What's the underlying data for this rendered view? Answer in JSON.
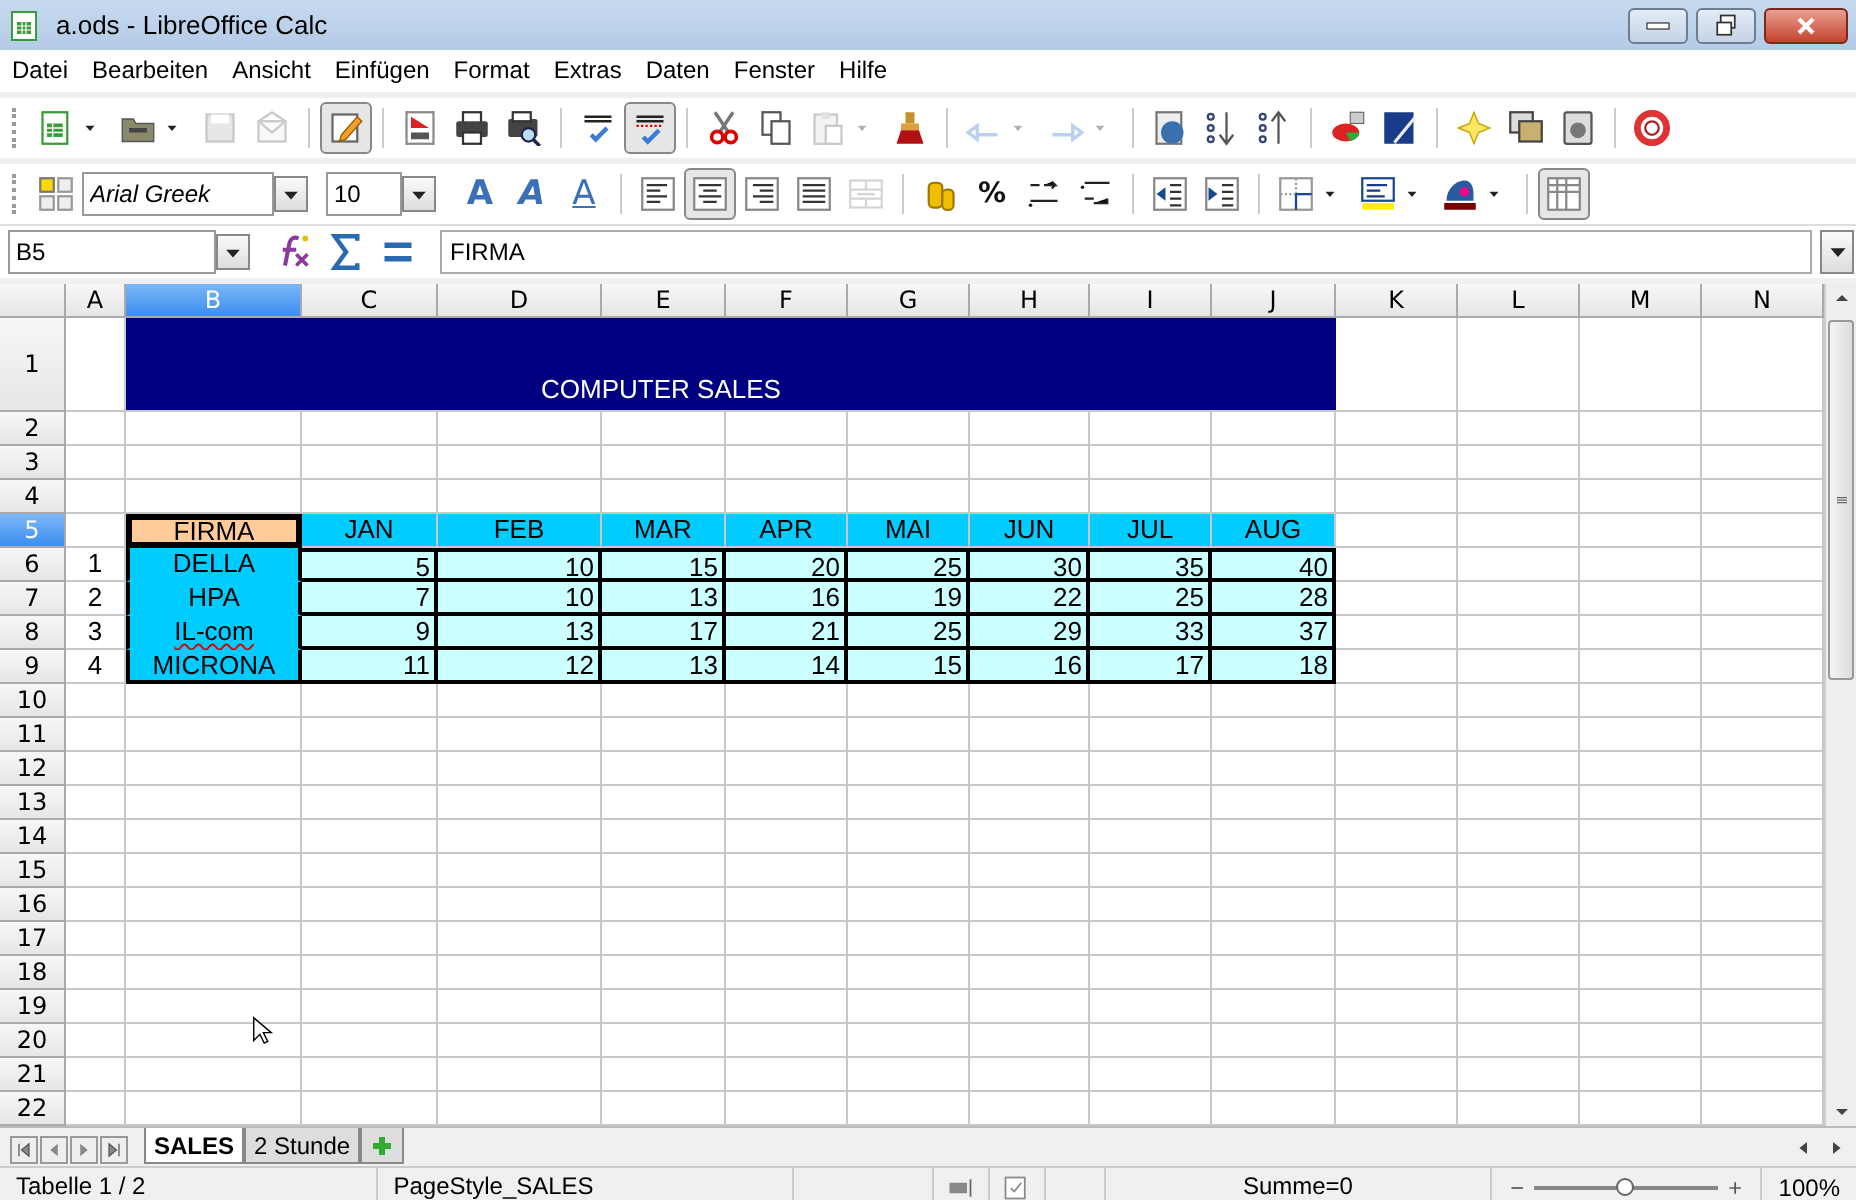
{
  "window": {
    "title": "a.ods - LibreOffice Calc"
  },
  "menu": [
    {
      "label": "Datei"
    },
    {
      "label": "Bearbeiten"
    },
    {
      "label": "Ansicht"
    },
    {
      "label": "Einfügen"
    },
    {
      "label": "Format"
    },
    {
      "label": "Extras"
    },
    {
      "label": "Daten"
    },
    {
      "label": "Fenster"
    },
    {
      "label": "Hilfe"
    }
  ],
  "standard_toolbar": [
    {
      "kind": "new",
      "dropdown": true,
      "pressed": false,
      "disabled": false
    },
    {
      "kind": "open",
      "dropdown": true,
      "pressed": false,
      "disabled": false
    },
    {
      "kind": "save",
      "dropdown": false,
      "pressed": false,
      "disabled": true
    },
    {
      "kind": "email",
      "dropdown": false,
      "pressed": false,
      "disabled": true
    },
    {
      "kind": "separator"
    },
    {
      "kind": "edit",
      "dropdown": false,
      "pressed": true,
      "disabled": false
    },
    {
      "kind": "separator"
    },
    {
      "kind": "pdf",
      "dropdown": false,
      "pressed": false,
      "disabled": false
    },
    {
      "kind": "print",
      "dropdown": false,
      "pressed": false,
      "disabled": false
    },
    {
      "kind": "preview",
      "dropdown": false,
      "pressed": false,
      "disabled": false
    },
    {
      "kind": "separator"
    },
    {
      "kind": "spell",
      "dropdown": false,
      "pressed": false,
      "disabled": false
    },
    {
      "kind": "autospell",
      "dropdown": false,
      "pressed": true,
      "disabled": false
    },
    {
      "kind": "separator"
    },
    {
      "kind": "cut",
      "dropdown": false,
      "pressed": false,
      "disabled": false
    },
    {
      "kind": "copy",
      "dropdown": false,
      "pressed": false,
      "disabled": false
    },
    {
      "kind": "paste",
      "dropdown": true,
      "pressed": false,
      "disabled": true
    },
    {
      "kind": "brush",
      "dropdown": false,
      "pressed": false,
      "disabled": false
    },
    {
      "kind": "separator"
    },
    {
      "kind": "undo",
      "dropdown": true,
      "pressed": false,
      "disabled": true
    },
    {
      "kind": "redo",
      "dropdown": true,
      "pressed": false,
      "disabled": true
    },
    {
      "kind": "separator"
    },
    {
      "kind": "navigator",
      "dropdown": false,
      "pressed": false,
      "disabled": false
    },
    {
      "kind": "sortasc",
      "dropdown": false,
      "pressed": false,
      "disabled": false
    },
    {
      "kind": "sortdesc",
      "dropdown": false,
      "pressed": false,
      "disabled": false
    },
    {
      "kind": "separator"
    },
    {
      "kind": "chart",
      "dropdown": false,
      "pressed": false,
      "disabled": false
    },
    {
      "kind": "draw",
      "dropdown": false,
      "pressed": false,
      "disabled": false
    },
    {
      "kind": "separator"
    },
    {
      "kind": "star",
      "dropdown": false,
      "pressed": false,
      "disabled": false
    },
    {
      "kind": "gallery",
      "dropdown": false,
      "pressed": false,
      "disabled": false
    },
    {
      "kind": "media",
      "dropdown": false,
      "pressed": false,
      "disabled": false
    },
    {
      "kind": "separator"
    },
    {
      "kind": "help",
      "dropdown": false,
      "pressed": false,
      "disabled": false
    }
  ],
  "formatting_toolbar": [
    {
      "kind": "styles",
      "dropdown": false,
      "pressed": false,
      "disabled": false
    },
    {
      "kind": "font-name",
      "value": "Arial Greek"
    },
    {
      "kind": "font-size",
      "value": "10"
    },
    {
      "kind": "bold",
      "glyph": "A",
      "dropdown": false,
      "pressed": false,
      "disabled": false
    },
    {
      "kind": "italic",
      "glyph": "A",
      "dropdown": false,
      "pressed": false,
      "disabled": false
    },
    {
      "kind": "underline",
      "glyph": "A",
      "dropdown": false,
      "pressed": false,
      "disabled": false
    },
    {
      "kind": "separator"
    },
    {
      "kind": "align-left",
      "dropdown": false,
      "pressed": false,
      "disabled": false
    },
    {
      "kind": "align-center",
      "dropdown": false,
      "pressed": true,
      "disabled": false
    },
    {
      "kind": "align-right",
      "dropdown": false,
      "pressed": false,
      "disabled": false
    },
    {
      "kind": "justify",
      "dropdown": false,
      "pressed": false,
      "disabled": false
    },
    {
      "kind": "merge",
      "dropdown": false,
      "pressed": false,
      "disabled": true
    },
    {
      "kind": "separator"
    },
    {
      "kind": "currency",
      "dropdown": false,
      "pressed": false,
      "disabled": false
    },
    {
      "kind": "percent",
      "glyph": "%",
      "dropdown": false,
      "pressed": false,
      "disabled": false
    },
    {
      "kind": "add-decimal",
      "dropdown": false,
      "pressed": false,
      "disabled": false
    },
    {
      "kind": "delete-decimal",
      "dropdown": false,
      "pressed": false,
      "disabled": false
    },
    {
      "kind": "separator"
    },
    {
      "kind": "outdent",
      "dropdown": false,
      "pressed": false,
      "disabled": false
    },
    {
      "kind": "indent",
      "dropdown": false,
      "pressed": false,
      "disabled": false
    },
    {
      "kind": "separator"
    },
    {
      "kind": "borders",
      "dropdown": true,
      "pressed": false,
      "disabled": false
    },
    {
      "kind": "background",
      "dropdown": true,
      "pressed": false,
      "disabled": false
    },
    {
      "kind": "fontcolor",
      "dropdown": true,
      "pressed": false,
      "disabled": false
    },
    {
      "kind": "separator"
    },
    {
      "kind": "gridlines",
      "dropdown": false,
      "pressed": true,
      "disabled": false
    }
  ],
  "formula_bar": {
    "cell_reference": "B5",
    "content": "FIRMA"
  },
  "sheet": {
    "columns": [
      {
        "label": "A",
        "selected": false
      },
      {
        "label": "B",
        "selected": true
      },
      {
        "label": "C",
        "selected": false
      },
      {
        "label": "D",
        "selected": false
      },
      {
        "label": "E",
        "selected": false
      },
      {
        "label": "F",
        "selected": false
      },
      {
        "label": "G",
        "selected": false
      },
      {
        "label": "H",
        "selected": false
      },
      {
        "label": "I",
        "selected": false
      },
      {
        "label": "J",
        "selected": false
      },
      {
        "label": "K",
        "selected": false
      },
      {
        "label": "L",
        "selected": false
      },
      {
        "label": "M",
        "selected": false
      },
      {
        "label": "N",
        "selected": false
      }
    ],
    "rows": [
      {
        "label": "1",
        "selected": false
      },
      {
        "label": "2",
        "selected": false
      },
      {
        "label": "3",
        "selected": false
      },
      {
        "label": "4",
        "selected": false
      },
      {
        "label": "5",
        "selected": true
      },
      {
        "label": "6",
        "selected": false
      },
      {
        "label": "7",
        "selected": false
      },
      {
        "label": "8",
        "selected": false
      },
      {
        "label": "9",
        "selected": false
      },
      {
        "label": "10",
        "selected": false
      },
      {
        "label": "11",
        "selected": false
      },
      {
        "label": "12",
        "selected": false
      },
      {
        "label": "13",
        "selected": false
      },
      {
        "label": "14",
        "selected": false
      },
      {
        "label": "15",
        "selected": false
      },
      {
        "label": "16",
        "selected": false
      },
      {
        "label": "17",
        "selected": false
      },
      {
        "label": "18",
        "selected": false
      },
      {
        "label": "19",
        "selected": false
      },
      {
        "label": "20",
        "selected": false
      },
      {
        "label": "21",
        "selected": false
      },
      {
        "label": "22",
        "selected": false
      }
    ],
    "banner": "COMPUTER SALES",
    "table": {
      "header": {
        "text": "FIRMA",
        "active": true
      },
      "months": [
        "JAN",
        "FEB",
        "MAR",
        "APR",
        "MAI",
        "JUN",
        "JUL",
        "AUG"
      ],
      "rows": [
        {
          "number": "1",
          "company": "DELLA",
          "misspelled": false,
          "values": [
            "5",
            "10",
            "15",
            "20",
            "25",
            "30",
            "35",
            "40"
          ]
        },
        {
          "number": "2",
          "company": "HPA",
          "misspelled": false,
          "values": [
            "7",
            "10",
            "13",
            "16",
            "19",
            "22",
            "25",
            "28"
          ]
        },
        {
          "number": "3",
          "company": "IL-com",
          "misspelled": true,
          "values": [
            "9",
            "13",
            "17",
            "21",
            "25",
            "29",
            "33",
            "37"
          ]
        },
        {
          "number": "4",
          "company": "MICRONA",
          "misspelled": false,
          "values": [
            "11",
            "12",
            "13",
            "14",
            "15",
            "16",
            "17",
            "18"
          ]
        }
      ]
    }
  },
  "sheet_tabs": [
    {
      "label": "SALES",
      "selected": true
    },
    {
      "label": "2 Stunde",
      "selected": false
    }
  ],
  "status_bar": {
    "sheet_position": "Tabelle 1 / 2",
    "page_style": "PageStyle_SALES",
    "sum": "Summe=0",
    "zoom": {
      "level": 0.5,
      "reading": "100%"
    }
  }
}
